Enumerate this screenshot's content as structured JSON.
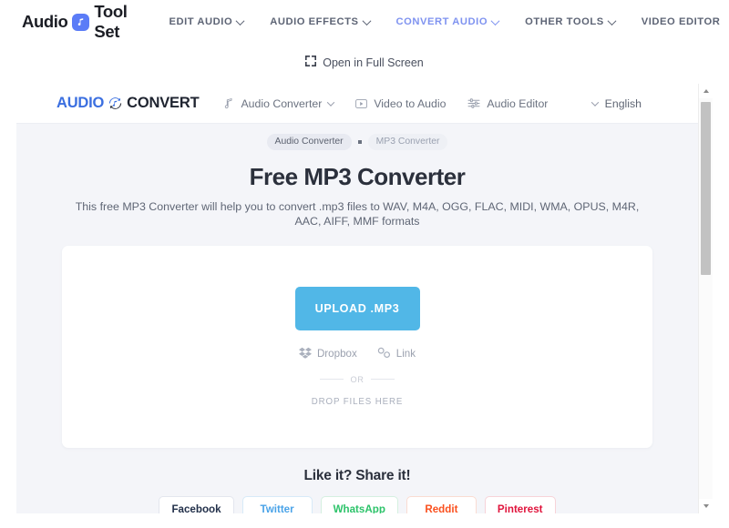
{
  "site": {
    "brand_text_1": "Audio",
    "brand_text_2": "Tool Set",
    "nav": [
      {
        "label": "EDIT AUDIO",
        "has_chevron": true,
        "active": false
      },
      {
        "label": "AUDIO EFFECTS",
        "has_chevron": true,
        "active": false
      },
      {
        "label": "CONVERT AUDIO",
        "has_chevron": true,
        "active": true
      },
      {
        "label": "OTHER TOOLS",
        "has_chevron": true,
        "active": false
      },
      {
        "label": "VIDEO EDITOR",
        "has_chevron": false,
        "active": false
      }
    ],
    "language_flag": "us-flag-icon",
    "fullscreen_label": "Open in Full Screen",
    "fullscreen_icon": "expand-icon",
    "accent_active": "#7f93f0"
  },
  "widget": {
    "logo_part1": "AUDIO",
    "logo_part2": "CONVERT",
    "logo_icon": "convert-arrows-icon",
    "menu": [
      {
        "label": "Audio Converter",
        "icon": "music-note-icon",
        "has_chevron": true
      },
      {
        "label": "Video to Audio",
        "icon": "play-box-icon",
        "has_chevron": false
      },
      {
        "label": "Audio Editor",
        "icon": "equalizer-icon",
        "has_chevron": false
      }
    ],
    "language": "English",
    "breadcrumbs": [
      {
        "label": "Audio Converter"
      },
      {
        "label": "MP3 Converter"
      }
    ],
    "title": "Free MP3 Converter",
    "subtitle": "This free MP3 Converter will help you to convert .mp3 files to WAV, M4A, OGG, FLAC, MIDI, WMA, OPUS, M4R, AAC, AIFF, MMF formats",
    "upload": {
      "button_label": "UPLOAD .MP3",
      "button_color": "#51b7e7",
      "dropbox_label": "Dropbox",
      "dropbox_icon": "dropbox-icon",
      "link_label": "Link",
      "link_icon": "chain-link-icon",
      "or_label": "OR",
      "drop_hint": "DROP FILES HERE"
    },
    "share": {
      "title": "Like it? Share it!",
      "buttons": [
        {
          "label": "Facebook",
          "color": "#22304a",
          "border": "#e3e6ee"
        },
        {
          "label": "Twitter",
          "color": "#4aa3e8",
          "border": "#d7eaf8"
        },
        {
          "label": "WhatsApp",
          "color": "#2dc36a",
          "border": "#d5f0e0"
        },
        {
          "label": "Reddit",
          "color": "#fa501e",
          "border": "#fadcd2"
        },
        {
          "label": "Pinterest",
          "color": "#e0143c",
          "border": "#f7d3d9"
        }
      ]
    }
  }
}
